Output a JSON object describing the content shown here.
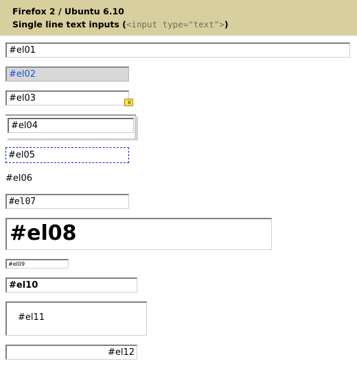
{
  "header": {
    "title": "Firefox 2 / Ubuntu 6.10",
    "subtitle_prefix": "Single line text inputs (",
    "subtitle_code": "<input type=\"text\">",
    "subtitle_suffix": ")"
  },
  "inputs": {
    "el01": "#el01",
    "el02": "#el02",
    "el03": "#el03",
    "el04": "#el04",
    "el05": "#el05",
    "el06": "#el06",
    "el07": "#el07",
    "el08": "#el08",
    "el09": "#el09",
    "el10": "#el10",
    "el11": "#el11",
    "el12": "#el12"
  }
}
